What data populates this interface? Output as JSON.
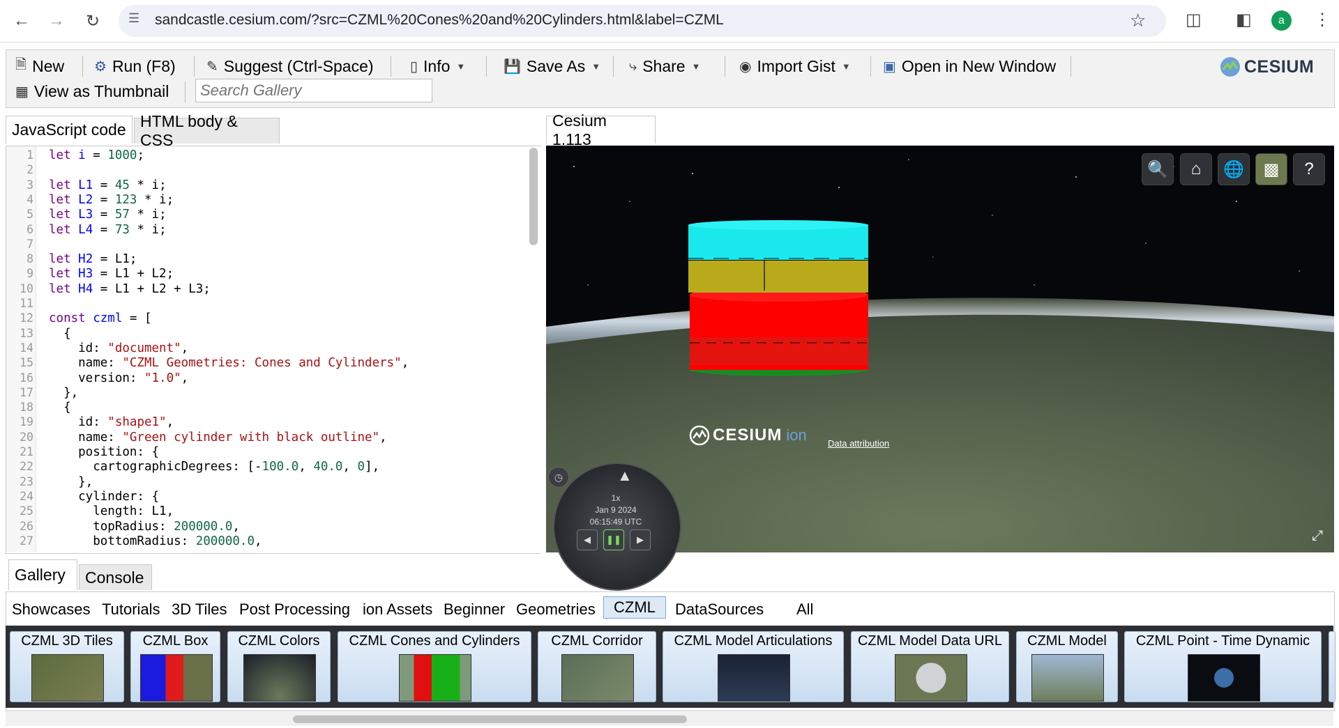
{
  "browser": {
    "url": "sandcastle.cesium.com/?src=CZML%20Cones%20and%20Cylinders.html&label=CZML",
    "avatar_letter": "a"
  },
  "toolbar": {
    "new_label": "New",
    "run_label": "Run (F8)",
    "suggest_label": "Suggest (Ctrl-Space)",
    "info_label": "Info",
    "save_as_label": "Save As",
    "share_label": "Share",
    "import_gist_label": "Import Gist",
    "open_window_label": "Open in New Window",
    "thumbnail_label": "View as Thumbnail",
    "search_placeholder": "Search Gallery",
    "logo_text": "CESIUM"
  },
  "editor": {
    "tabs": [
      "JavaScript code",
      "HTML body & CSS"
    ],
    "line_numbers": [
      "1",
      "2",
      "3",
      "4",
      "5",
      "6",
      "7",
      "8",
      "9",
      "10",
      "11",
      "12",
      "13",
      "14",
      "15",
      "16",
      "17",
      "18",
      "19",
      "20",
      "21",
      "22",
      "23",
      "24",
      "25",
      "26",
      "27"
    ],
    "code_lines": [
      "let i = 1000;",
      "",
      "let L1 = 45 * i;",
      "let L2 = 123 * i;",
      "let L3 = 57 * i;",
      "let L4 = 73 * i;",
      "",
      "let H2 = L1;",
      "let H3 = L1 + L2;",
      "let H4 = L1 + L2 + L3;",
      "",
      "const czml = [",
      "  {",
      "    id: \"document\",",
      "    name: \"CZML Geometries: Cones and Cylinders\",",
      "    version: \"1.0\",",
      "  },",
      "  {",
      "    id: \"shape1\",",
      "    name: \"Green cylinder with black outline\",",
      "    position: {",
      "      cartographicDegrees: [-100.0, 40.0, 0],",
      "    },",
      "    cylinder: {",
      "      length: L1,",
      "      topRadius: 200000.0,",
      "      bottomRadius: 200000.0,"
    ]
  },
  "viewer": {
    "tab_label": "Cesium 1.113",
    "ion_logo_main": "CESIUM",
    "ion_logo_sub": "ion",
    "attribution": "Data attribution",
    "speed": "1x",
    "date": "Jan 9 2024",
    "time": "06:15:49 UTC",
    "toolbar_icons": [
      "search-icon",
      "home-icon",
      "globe-icon",
      "base-layer-picker-icon",
      "help-icon"
    ]
  },
  "bottom": {
    "tabs": [
      "Gallery",
      "Console"
    ],
    "categories": [
      "Showcases",
      "Tutorials",
      "3D Tiles",
      "Post Processing",
      "ion Assets",
      "Beginner",
      "Geometries",
      "CZML",
      "DataSources",
      "All"
    ],
    "active_category": "CZML",
    "thumbnails": [
      "CZML 3D Tiles",
      "CZML Box",
      "CZML Colors",
      "CZML Cones and Cylinders",
      "CZML Corridor",
      "CZML Model Articulations",
      "CZML Model Data URL",
      "CZML Model",
      "CZML Point - Time Dynamic"
    ]
  }
}
